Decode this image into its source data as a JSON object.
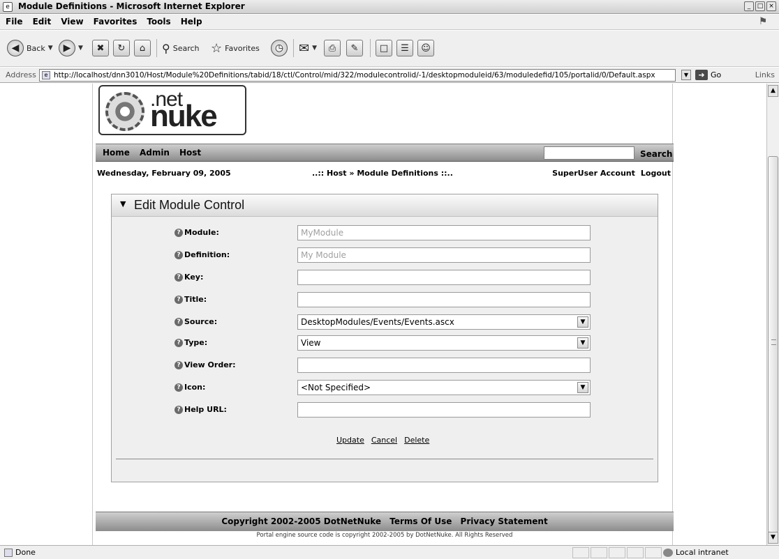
{
  "window": {
    "title": "Module Definitions - Microsoft Internet Explorer",
    "controls": [
      "_",
      "□",
      "×"
    ]
  },
  "menu": [
    "File",
    "Edit",
    "View",
    "Favorites",
    "Tools",
    "Help"
  ],
  "toolbar": {
    "back_label": "Back",
    "search_label": "Search",
    "favorites_label": "Favorites"
  },
  "address": {
    "label": "Address",
    "url": "http://localhost/dnn3010/Host/Module%20Definitions/tabid/18/ctl/Control/mid/322/modulecontrolid/-1/desktopmoduleid/63/moduledefid/105/portalid/0/Default.aspx",
    "go_label": "Go",
    "links_label": "Links"
  },
  "site": {
    "logo_net": ".net",
    "logo_nuke": "nuke",
    "nav": [
      "Home",
      "Admin",
      "Host"
    ],
    "search_button": "Search",
    "date": "Wednesday, February 09, 2005",
    "breadcrumb": "..:: Host » Module Definitions ::..",
    "user_link": "SuperUser Account",
    "logout_link": "Logout"
  },
  "form": {
    "title": "Edit Module Control",
    "fields": [
      {
        "label": "Module:",
        "value": "MyModule"
      },
      {
        "label": "Definition:",
        "value": "My Module"
      },
      {
        "label": "Key:",
        "value": ""
      },
      {
        "label": "Title:",
        "value": ""
      },
      {
        "label": "Source:",
        "value": "DesktopModules/Events/Events.ascx"
      },
      {
        "label": "Type:",
        "value": "View"
      },
      {
        "label": "View Order:",
        "value": ""
      },
      {
        "label": "Icon:",
        "value": "<Not Specified>"
      },
      {
        "label": "Help URL:",
        "value": ""
      }
    ],
    "actions": [
      "Update",
      "Cancel",
      "Delete"
    ]
  },
  "footer": {
    "copyright": "Copyright 2002-2005 DotNetNuke",
    "terms": "Terms Of Use",
    "privacy": "Privacy Statement",
    "fine_print": "Portal engine source code is copyright 2002-2005 by DotNetNuke. All Rights Reserved"
  },
  "status": {
    "text": "Done",
    "zone": "Local intranet"
  }
}
